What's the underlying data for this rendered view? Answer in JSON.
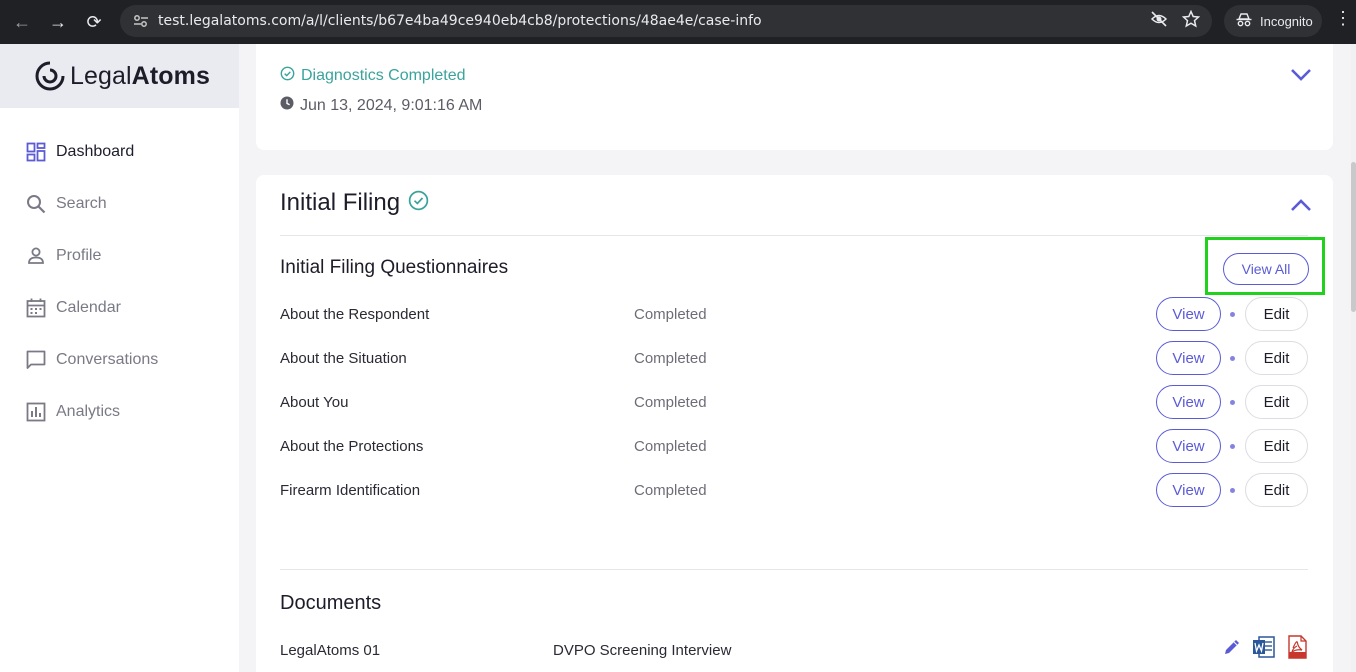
{
  "browser": {
    "url": "test.legalatoms.com/a/l/clients/b67e4ba49ce940eb4cb8/protections/48ae4e/case-info",
    "incognito_label": "Incognito"
  },
  "sidebar": {
    "logo_light": "Legal",
    "logo_bold": "Atoms",
    "items": [
      {
        "label": "Dashboard",
        "icon": "dashboard-icon",
        "active": true
      },
      {
        "label": "Search",
        "icon": "search-icon"
      },
      {
        "label": "Profile",
        "icon": "person-icon"
      },
      {
        "label": "Calendar",
        "icon": "calendar-icon"
      },
      {
        "label": "Conversations",
        "icon": "chat-icon"
      },
      {
        "label": "Analytics",
        "icon": "analytics-icon"
      }
    ]
  },
  "diagnostics": {
    "status": "Diagnostics Completed",
    "timestamp": "Jun 13, 2024, 9:01:16 AM"
  },
  "initial_filing": {
    "title": "Initial Filing",
    "questionnaires_title": "Initial Filing Questionnaires",
    "view_all_label": "View All",
    "view_label": "View",
    "edit_label": "Edit",
    "questionnaires": [
      {
        "name": "About the Respondent",
        "status": "Completed"
      },
      {
        "name": "About the Situation",
        "status": "Completed"
      },
      {
        "name": "About You",
        "status": "Completed"
      },
      {
        "name": "About the Protections",
        "status": "Completed"
      },
      {
        "name": "Firearm Identification",
        "status": "Completed"
      }
    ],
    "documents_title": "Documents",
    "documents": [
      {
        "name": "LegalAtoms 01",
        "description": "DVPO Screening Interview"
      }
    ]
  },
  "colors": {
    "accent": "#5b5bd6",
    "success": "#3aa39c",
    "highlight": "#22d11d"
  }
}
